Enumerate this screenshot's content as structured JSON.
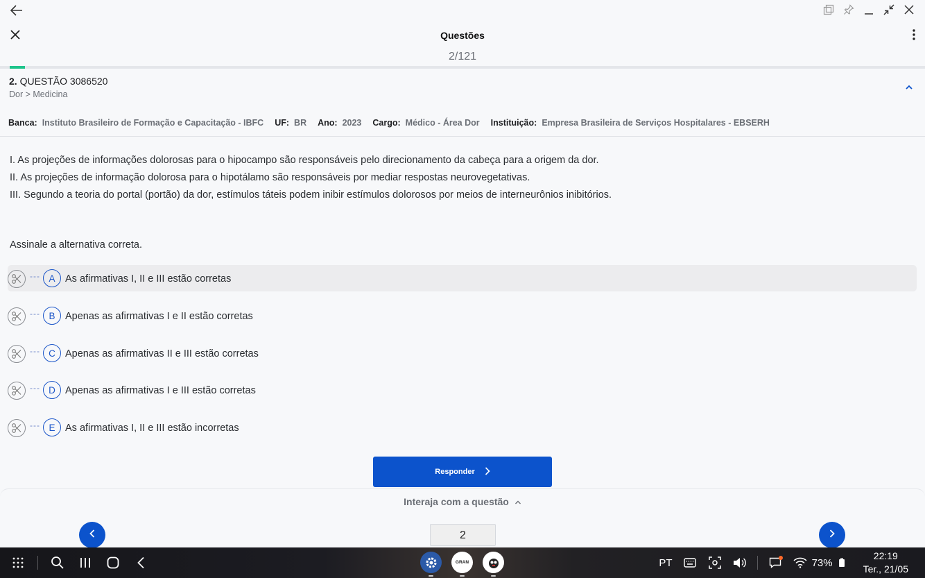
{
  "window": {
    "back_icon": "arrow-left-icon",
    "controls": [
      "split-view-icon",
      "pin-icon",
      "minimize-icon",
      "shrink-icon",
      "close-icon"
    ]
  },
  "header": {
    "title": "Questões",
    "counter": "2/121",
    "progress_fraction": 0.0165
  },
  "question": {
    "number": "2.",
    "code": "QUESTÃO 3086520",
    "breadcrumb": "Dor > Medicina",
    "meta": {
      "banca_label": "Banca:",
      "banca_value": "Instituto Brasileiro de Formação e Capacitação - IBFC",
      "uf_label": "UF:",
      "uf_value": "BR",
      "ano_label": "Ano:",
      "ano_value": "2023",
      "cargo_label": "Cargo:",
      "cargo_value": "Médico - Área Dor",
      "instituicao_label": "Instituição:",
      "instituicao_value": "Empresa Brasileira de Serviços Hospitalares - EBSERH"
    },
    "statements": [
      "I. As projeções de informações dolorosas para o hipocampo são responsáveis pelo direcionamento da cabeça para a origem da dor.",
      "II. As projeções de informação dolorosa para o hipotálamo são responsáveis por mediar respostas neurovegetativas.",
      "III. Segundo a teoria do portal (portão) da dor, estímulos táteis podem inibir estímulos dolorosos por meios de interneurônios inibitórios."
    ],
    "prompt": "Assinale a alternativa correta.",
    "options": [
      {
        "letter": "A",
        "text": "As afirmativas I, II e III estão corretas",
        "selected": true
      },
      {
        "letter": "B",
        "text": "Apenas as afirmativas I e II estão corretas",
        "selected": false
      },
      {
        "letter": "C",
        "text": "Apenas as afirmativas II e III estão corretas",
        "selected": false
      },
      {
        "letter": "D",
        "text": "Apenas as afirmativas I e III estão corretas",
        "selected": false
      },
      {
        "letter": "E",
        "text": "As afirmativas I, II e III estão incorretas",
        "selected": false
      }
    ],
    "option_dash": "---"
  },
  "actions": {
    "respond_label": "Responder",
    "interact_label": "Interaja com a questão",
    "page_value": "2"
  },
  "taskbar": {
    "language": "PT",
    "battery": "73%",
    "time": "22:19",
    "date": "Ter., 21/05",
    "gran_label": "GRAN"
  },
  "colors": {
    "accent": "#0c53cc",
    "progress": "#1ec48b",
    "option_letter": "#1d57c9"
  }
}
